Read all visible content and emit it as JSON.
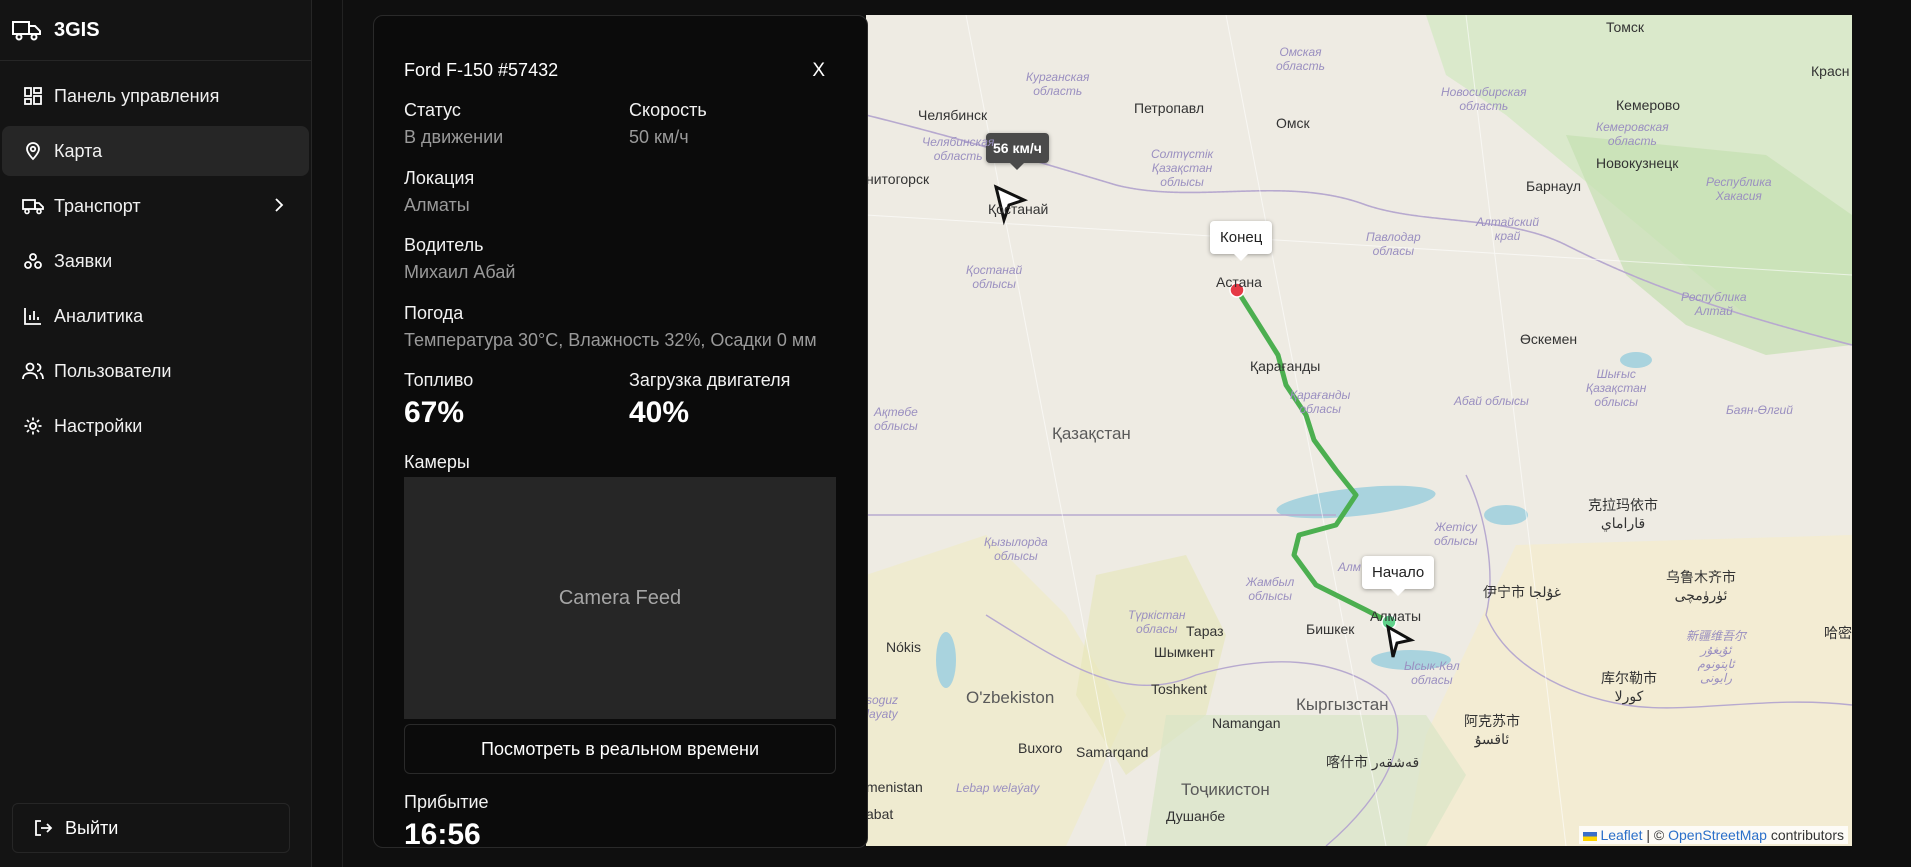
{
  "app": {
    "name": "3GIS"
  },
  "sidebar": {
    "items": [
      {
        "label": "Панель управления",
        "icon": "dashboard-icon",
        "active": false
      },
      {
        "label": "Карта",
        "icon": "map-pin-icon",
        "active": true
      },
      {
        "label": "Транспорт",
        "icon": "truck-icon",
        "active": false,
        "has_submenu": true
      },
      {
        "label": "Заявки",
        "icon": "requests-icon",
        "active": false
      },
      {
        "label": "Аналитика",
        "icon": "chart-icon",
        "active": false
      },
      {
        "label": "Пользователи",
        "icon": "users-icon",
        "active": false
      },
      {
        "label": "Настройки",
        "icon": "gear-icon",
        "active": false
      }
    ],
    "logout_label": "Выйти"
  },
  "vehicle": {
    "title": "Ford F-150 #57432",
    "close_label": "X",
    "status_label": "Статус",
    "status_value": "В движении",
    "speed_label": "Скорость",
    "speed_value": "50 км/ч",
    "location_label": "Локация",
    "location_value": "Алматы",
    "driver_label": "Водитель",
    "driver_value": "Михаил Абай",
    "weather_label": "Погода",
    "weather_value": "Температура 30°С, Влажность 32%, Осадки 0 мм",
    "fuel_label": "Топливо",
    "fuel_value": "67%",
    "engine_label": "Загрузка двигателя",
    "engine_value": "40%",
    "cameras_label": "Камеры",
    "camera_placeholder": "Camera Feed",
    "live_button": "Посмотреть в реальном времени",
    "arrival_label": "Прибытие",
    "arrival_value": "16:56"
  },
  "map": {
    "end_tooltip": "Конец",
    "start_tooltip": "Начало",
    "speed_tooltip": "56 км/ч",
    "route_color": "#4caf50",
    "end_marker_color": "#e53945",
    "start_marker_color": "#5fd18a",
    "attribution": {
      "leaflet": "Leaflet",
      "sep": "| ©",
      "osm": "OpenStreetMap",
      "suffix": "contributors"
    },
    "labels": {
      "tomsk": "Томск",
      "krasn": "Красн",
      "omskaya": "Омская\nобласть",
      "novosib_obl": "Новосибирская\nобласть",
      "kurgan_obl": "Курганская\nобласть",
      "chelyabinsk": "Челябинск",
      "petropavl": "Петропавл",
      "omsk": "Омск",
      "kemerovo": "Кемерово",
      "kemerovo_obl": "Кемеровская\nобласть",
      "novokuzn": "Новокузнецк",
      "barnaul": "Барнаул",
      "khakasia": "Республика\nХакасия",
      "chelyab_obl": "Челябинская\nобласть",
      "magnitog": "нитогорск",
      "kostanai": "Қостанай",
      "soltustik": "Солтүстік\nҚазақстан\nоблысы",
      "altai_krai": "Алтайский\nкрай",
      "pavlodar_obl": "Павлодар\nобласы",
      "astana": "Астана",
      "kostanai_obl": "Қостанай\nоблысы",
      "altai_rep": "Республика\nАлтай",
      "oskemen": "Өскемен",
      "karaganda": "Қарағанды",
      "karaganda_obl": "Қарағанды\nобласы",
      "aktobe_obl": "Ақтөбе\nоблысы",
      "kazakhstan": "Қазақстан",
      "abai_obl": "Абай облысы",
      "shygys": "Шығыс\nҚазақстан\nоблысы",
      "bayan": "Баян-Өлгий",
      "karamay": "克拉玛依市\nقاراماي",
      "zhetisu": "Жетісу\nоблысы",
      "kyzylorda_obl": "Қызылорда\nоблысы",
      "zhambyl_obl": "Жамбыл\nоблысы",
      "almaty_short": "Алм",
      "yili": "伊宁市 غۇلجا",
      "urumqi": "乌鲁木齐市\nئۈرۈمچى",
      "almaty_city": "Алматы",
      "turkistan_obl": "Түркістан\nобласы",
      "taraz": "Тараз",
      "bishkek": "Бишкек",
      "nokis": "Nókis",
      "shymkent": "Шымкент",
      "xinjiang": "新疆维吾尔\nئۇيغۇر\nئاپتونوم\nرايونى",
      "issyk": "Ысык-Көл\nобласы",
      "korla": "库尔勒市\nكورلا",
      "hami": "哈密",
      "uzbekistan": "O'zbekiston",
      "toshkent": "Toshkent",
      "kyrgyzstan": "Кыргызстан",
      "aksu": "阿克苏市\nئاقسۇ",
      "soguz": "soguz\nlayaty",
      "namangan": "Namangan",
      "buxoro": "Buxoro",
      "samarqand": "Samarqand",
      "kashgar": "喀什市 قەشقەر",
      "tojikiston": "Тоҷикистон",
      "menistan": "menistan",
      "lebap": "Lebap welaýaty",
      "dushanbe": "Душанбе",
      "abat": "abat"
    }
  }
}
